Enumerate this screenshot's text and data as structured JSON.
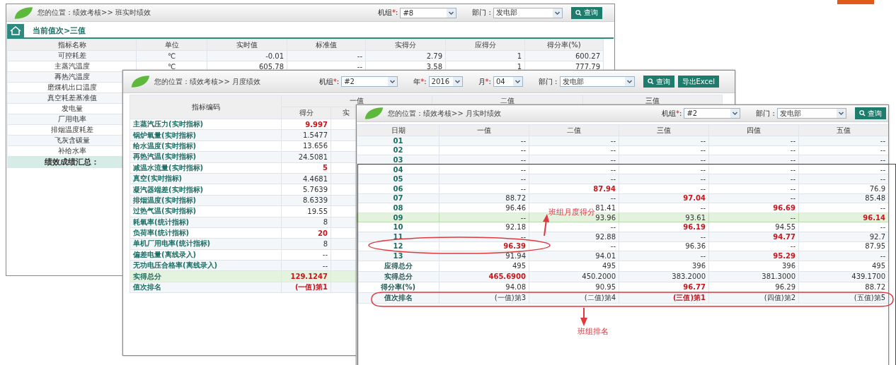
{
  "shift_window": {
    "breadcrumb": "您的位置：绩效考核>> 班实时绩效",
    "filters": [
      {
        "kind": "unit",
        "label": "机组",
        "mark": "*",
        "suffix": ":",
        "value": "#8"
      },
      {
        "kind": "dept",
        "label": "部门",
        "suffix": " :",
        "value": "发电部"
      }
    ],
    "buttons": [
      {
        "kind": "search",
        "text": "查询"
      }
    ],
    "section_title": "当前值次>三值",
    "columns": [
      "指标名称",
      "单位",
      "实时值",
      "标准值",
      "实得分",
      "应得分",
      "得分率(%)"
    ],
    "rows": [
      {
        "kind": "data",
        "cells": [
          "可控耗差",
          "℃",
          "-0.01",
          "--",
          "2.79",
          "1",
          "600.27"
        ]
      },
      {
        "kind": "data",
        "cells": [
          "主蒸汽温度",
          "℃",
          "605.78",
          "--",
          "3.58",
          "1",
          "777.79"
        ]
      },
      {
        "kind": "data",
        "cells": [
          "再热汽温度"
        ]
      },
      {
        "kind": "data",
        "cells": [
          "磨煤机出口温度"
        ]
      },
      {
        "kind": "data",
        "cells": [
          "真空耗差基准值"
        ]
      },
      {
        "kind": "data",
        "cells": [
          "发电量"
        ]
      },
      {
        "kind": "data",
        "cells": [
          "厂用电率"
        ]
      },
      {
        "kind": "data",
        "cells": [
          "排烟温度耗差"
        ]
      },
      {
        "kind": "data",
        "cells": [
          "飞灰含碳量"
        ]
      },
      {
        "kind": "data",
        "cells": [
          "补给水率"
        ]
      },
      {
        "kind": "summary",
        "cells": [
          "绩效成绩汇总："
        ]
      }
    ]
  },
  "monthly_window": {
    "breadcrumb": "您的位置：绩效考核>> 月度绩效",
    "filters": [
      {
        "kind": "unit",
        "label": "机组",
        "mark": "*",
        "suffix": ":",
        "value": "#2"
      },
      {
        "kind": "year",
        "label": "年",
        "mark": "*",
        "suffix": ":",
        "value": "2016"
      },
      {
        "kind": "month",
        "label": "月",
        "mark": "*",
        "suffix": ":",
        "value": "04"
      },
      {
        "kind": "dept",
        "label": "部门",
        "suffix": " :",
        "value": "发电部"
      }
    ],
    "buttons": [
      {
        "kind": "search",
        "text": "查询"
      },
      {
        "kind": "export",
        "text": "导出Excel"
      }
    ],
    "name_header": "指标编码",
    "groups": [
      "一值",
      "二值",
      "三值"
    ],
    "subheaders": [
      "得分",
      "实"
    ],
    "rows": [
      {
        "kind": "data",
        "name": "主蒸汽压力(实时指标)",
        "score": {
          "text": "9.997",
          "highlight": true
        }
      },
      {
        "kind": "data",
        "name": "锅炉氧量(实时指标)",
        "score": {
          "text": "1.5477",
          "highlight": false
        }
      },
      {
        "kind": "data",
        "name": "给水温度(实时指标)",
        "score": {
          "text": "13.656",
          "highlight": false
        }
      },
      {
        "kind": "data",
        "name": "再热汽温(实时指标)",
        "score": {
          "text": "24.5081",
          "highlight": false
        }
      },
      {
        "kind": "data",
        "name": "减温水流量(实时指标)",
        "score": {
          "text": "5",
          "highlight": true
        }
      },
      {
        "kind": "data",
        "name": "真空(实时指标)",
        "score": {
          "text": "4.4681",
          "highlight": false
        }
      },
      {
        "kind": "data",
        "name": "凝汽器端差(实时指标)",
        "score": {
          "text": "5.7639",
          "highlight": false
        }
      },
      {
        "kind": "data",
        "name": "排烟温度(实时指标)",
        "score": {
          "text": "8.6339",
          "highlight": false
        }
      },
      {
        "kind": "data",
        "name": "过热气温(实时指标)",
        "score": {
          "text": "19.55",
          "highlight": false
        }
      },
      {
        "kind": "data",
        "name": "耗氧率(统计指标)",
        "score": {
          "text": "8",
          "highlight": false
        }
      },
      {
        "kind": "data",
        "name": "负荷率(统计指标)",
        "score": {
          "text": "20",
          "highlight": true
        }
      },
      {
        "kind": "data",
        "name": "单机厂用电率(统计指标)",
        "score": {
          "text": "8",
          "highlight": false
        }
      },
      {
        "kind": "data",
        "name": "偏差电量(离线录入)",
        "score": {
          "text": "--",
          "highlight": false
        }
      },
      {
        "kind": "data",
        "name": "无功电压合格率(离线录入)",
        "score": {
          "text": "--",
          "highlight": false
        }
      },
      {
        "kind": "total",
        "name": "实得总分",
        "score": {
          "text": "129.1247",
          "highlight": true
        }
      },
      {
        "kind": "data",
        "name": "值次排名",
        "score": {
          "text": "(一值)第1",
          "highlight": true
        }
      }
    ]
  },
  "monthly_realtime_window": {
    "breadcrumb": "您的位置：绩效考核>> 月实时绩效",
    "filters": [
      {
        "kind": "unit",
        "label": "机组",
        "mark": "*",
        "suffix": ":",
        "value": "#2"
      },
      {
        "kind": "dept",
        "label": "部门",
        "suffix": " :",
        "value": "发电部"
      }
    ],
    "buttons": [
      {
        "kind": "search",
        "text": "查询"
      }
    ],
    "label_column": "日期",
    "columns": [
      "一值",
      "二值",
      "三值",
      "四值",
      "五值"
    ],
    "rows": [
      {
        "kind": "data",
        "label": "01",
        "selected": false,
        "cells": [
          {
            "text": "--",
            "highlight": false
          },
          {
            "text": "--",
            "highlight": false
          },
          {
            "text": "--",
            "highlight": false
          },
          {
            "text": "--",
            "highlight": false
          },
          {
            "text": "--",
            "highlight": false
          }
        ]
      },
      {
        "kind": "data",
        "label": "02",
        "selected": false,
        "cells": [
          {
            "text": "--",
            "highlight": false
          },
          {
            "text": "--",
            "highlight": false
          },
          {
            "text": "--",
            "highlight": false
          },
          {
            "text": "--",
            "highlight": false
          },
          {
            "text": "--",
            "highlight": false
          }
        ]
      },
      {
        "kind": "data",
        "label": "03",
        "selected": false,
        "cells": [
          {
            "text": "--",
            "highlight": false
          },
          {
            "text": "--",
            "highlight": false
          },
          {
            "text": "--",
            "highlight": false
          },
          {
            "text": "--",
            "highlight": false
          },
          {
            "text": "--",
            "highlight": false
          }
        ]
      },
      {
        "kind": "data",
        "label": "04",
        "selected": false,
        "cells": [
          {
            "text": "--",
            "highlight": false
          },
          {
            "text": "--",
            "highlight": false
          },
          {
            "text": "--",
            "highlight": false
          },
          {
            "text": "--",
            "highlight": false
          },
          {
            "text": "--",
            "highlight": false
          }
        ]
      },
      {
        "kind": "data",
        "label": "05",
        "selected": false,
        "cells": [
          {
            "text": "--",
            "highlight": false
          },
          {
            "text": "--",
            "highlight": false
          },
          {
            "text": "--",
            "highlight": false
          },
          {
            "text": "--",
            "highlight": false
          },
          {
            "text": "--",
            "highlight": false
          }
        ]
      },
      {
        "kind": "data",
        "label": "06",
        "selected": false,
        "cells": [
          {
            "text": "--",
            "highlight": false
          },
          {
            "text": "87.94",
            "highlight": true
          },
          {
            "text": "--",
            "highlight": false
          },
          {
            "text": "--",
            "highlight": false
          },
          {
            "text": "76.9",
            "highlight": false
          }
        ]
      },
      {
        "kind": "data",
        "label": "07",
        "selected": false,
        "cells": [
          {
            "text": "88.72",
            "highlight": false
          },
          {
            "text": "--",
            "highlight": false
          },
          {
            "text": "97.04",
            "highlight": true
          },
          {
            "text": "--",
            "highlight": false
          },
          {
            "text": "85.48",
            "highlight": false
          }
        ]
      },
      {
        "kind": "data",
        "label": "08",
        "selected": false,
        "cells": [
          {
            "text": "96.46",
            "highlight": false
          },
          {
            "text": "81.41",
            "highlight": false
          },
          {
            "text": "--",
            "highlight": false
          },
          {
            "text": "96.69",
            "highlight": true
          },
          {
            "text": "--",
            "highlight": false
          }
        ]
      },
      {
        "kind": "data",
        "label": "09",
        "selected": true,
        "cells": [
          {
            "text": "--",
            "highlight": false
          },
          {
            "text": "93.96",
            "highlight": false
          },
          {
            "text": "93.61",
            "highlight": false
          },
          {
            "text": "--",
            "highlight": false
          },
          {
            "text": "96.14",
            "highlight": true
          }
        ]
      },
      {
        "kind": "data",
        "label": "10",
        "selected": false,
        "cells": [
          {
            "text": "92.18",
            "highlight": false
          },
          {
            "text": "--",
            "highlight": false
          },
          {
            "text": "96.19",
            "highlight": true
          },
          {
            "text": "94.55",
            "highlight": false
          },
          {
            "text": "--",
            "highlight": false
          }
        ]
      },
      {
        "kind": "data",
        "label": "11",
        "selected": false,
        "cells": [
          {
            "text": "--",
            "highlight": false
          },
          {
            "text": "92.88",
            "highlight": false
          },
          {
            "text": "--",
            "highlight": false
          },
          {
            "text": "94.77",
            "highlight": true
          },
          {
            "text": "92.7",
            "highlight": false
          }
        ]
      },
      {
        "kind": "data",
        "label": "12",
        "selected": false,
        "cells": [
          {
            "text": "96.39",
            "highlight": true
          },
          {
            "text": "--",
            "highlight": false
          },
          {
            "text": "96.36",
            "highlight": false
          },
          {
            "text": "--",
            "highlight": false
          },
          {
            "text": "87.95",
            "highlight": false
          }
        ]
      },
      {
        "kind": "data",
        "label": "13",
        "selected": false,
        "cells": [
          {
            "text": "91.94",
            "highlight": false
          },
          {
            "text": "94.01",
            "highlight": false
          },
          {
            "text": "--",
            "highlight": false
          },
          {
            "text": "95.29",
            "highlight": true
          },
          {
            "text": "--",
            "highlight": false
          }
        ]
      },
      {
        "kind": "summary",
        "label": "应得总分",
        "selected": false,
        "cells": [
          {
            "text": "495",
            "highlight": false
          },
          {
            "text": "495",
            "highlight": false
          },
          {
            "text": "396",
            "highlight": false
          },
          {
            "text": "396",
            "highlight": false
          },
          {
            "text": "495",
            "highlight": false
          }
        ]
      },
      {
        "kind": "summary",
        "label": "实得总分",
        "selected": false,
        "cells": [
          {
            "text": "465.6900",
            "highlight": true
          },
          {
            "text": "450.2000",
            "highlight": false
          },
          {
            "text": "383.2000",
            "highlight": false
          },
          {
            "text": "381.3000",
            "highlight": false
          },
          {
            "text": "439.1700",
            "highlight": false
          }
        ]
      },
      {
        "kind": "summary",
        "label": "得分率(%)",
        "selected": false,
        "cells": [
          {
            "text": "94.08",
            "highlight": false
          },
          {
            "text": "90.95",
            "highlight": false
          },
          {
            "text": "96.77",
            "highlight": true
          },
          {
            "text": "96.29",
            "highlight": false
          },
          {
            "text": "88.72",
            "highlight": false
          }
        ]
      },
      {
        "kind": "summary",
        "label": "值次排名",
        "selected": false,
        "cells": [
          {
            "text": "(一值)第3",
            "highlight": false
          },
          {
            "text": "(二值)第4",
            "highlight": false
          },
          {
            "text": "(三值)第1",
            "highlight": true
          },
          {
            "text": "(四值)第2",
            "highlight": false
          },
          {
            "text": "(五值)第5",
            "highlight": false
          }
        ]
      }
    ]
  },
  "annotations": {
    "score_label": "班组月度得分",
    "rank_label": "班组排名"
  }
}
